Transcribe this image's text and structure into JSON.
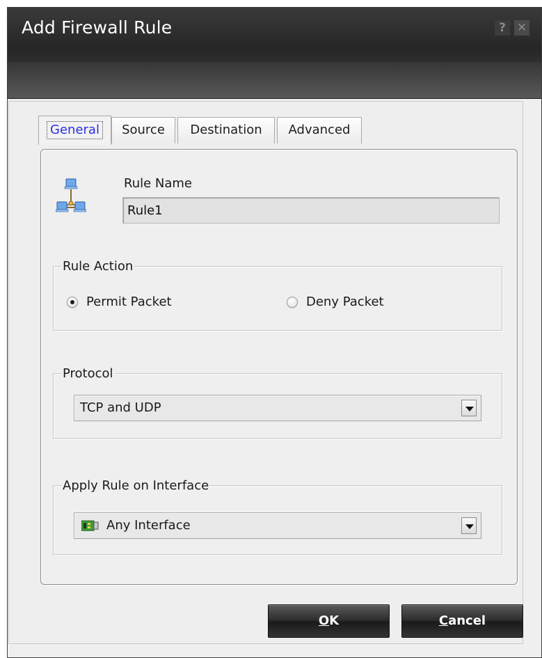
{
  "window": {
    "title": "Add Firewall Rule",
    "help_label": "?",
    "close_label": "✕"
  },
  "tabs": [
    {
      "label": "General",
      "active": true
    },
    {
      "label": "Source",
      "active": false
    },
    {
      "label": "Destination",
      "active": false
    },
    {
      "label": "Advanced",
      "active": false
    }
  ],
  "general": {
    "rule_name_label": "Rule Name",
    "rule_name_value": "Rule1",
    "rule_icon": "network-icon",
    "rule_action": {
      "legend": "Rule Action",
      "options": [
        {
          "label": "Permit Packet",
          "checked": true
        },
        {
          "label": "Deny Packet",
          "checked": false
        }
      ]
    },
    "protocol": {
      "legend": "Protocol",
      "selected": "TCP and UDP"
    },
    "interface": {
      "legend": "Apply Rule on Interface",
      "selected": "Any Interface",
      "icon": "network-card-icon"
    }
  },
  "buttons": {
    "ok_first": "O",
    "ok_rest": "K",
    "cancel_first": "C",
    "cancel_rest": "ancel"
  }
}
